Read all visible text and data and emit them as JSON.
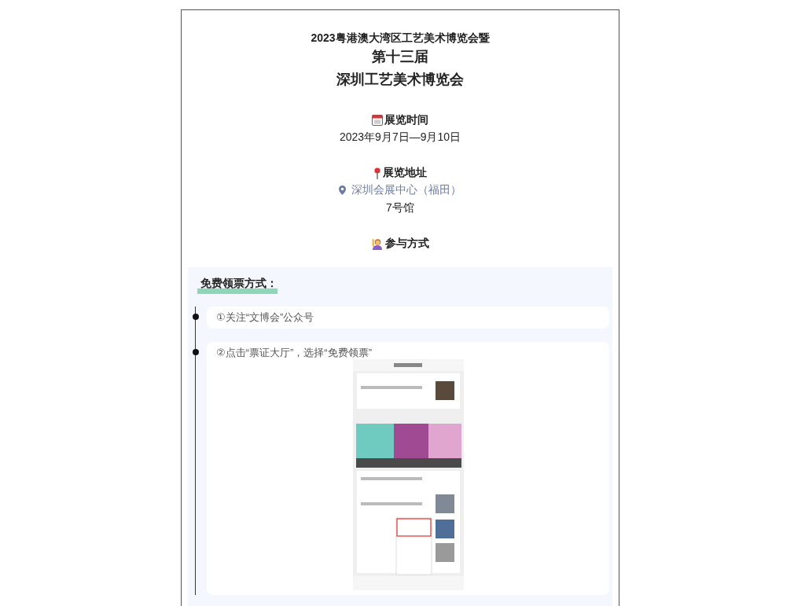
{
  "header": {
    "subtitle": "2023粤港澳大湾区工艺美术博览会暨",
    "title_lines": [
      "第十三届",
      "深圳工艺美术博览会"
    ]
  },
  "sections": [
    {
      "heading": "展览时间",
      "lines": [
        {
          "kind": "plain",
          "text": "2023年9月7日—9月10日"
        }
      ]
    },
    {
      "heading": "展览地址",
      "lines": [
        {
          "kind": "location",
          "text": "深圳会展中心（福田）"
        },
        {
          "kind": "plain",
          "text": "7号馆"
        }
      ]
    },
    {
      "heading": "参与方式"
    }
  ],
  "tickets": {
    "heading": "免费领票方式：",
    "steps": [
      {
        "text": "①关注“文博会”公众号"
      },
      {
        "text": "②点击“票证大厅”，选择“免费领票”"
      }
    ]
  }
}
